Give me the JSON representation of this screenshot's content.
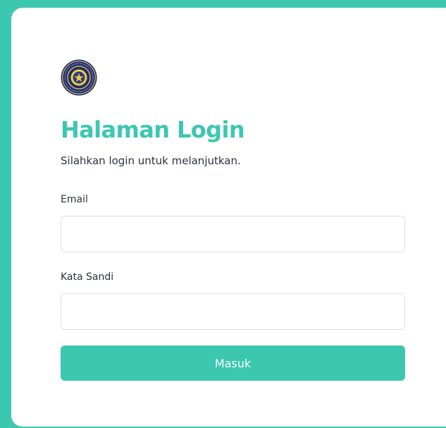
{
  "colors": {
    "accent": "#3cc7b1",
    "text": "#2e3140",
    "background": "#ffffff",
    "input_border": "#dde0e6"
  },
  "logo": {
    "icon": "university-seal-icon"
  },
  "header": {
    "title": "Halaman Login",
    "subtitle": "Silahkan login untuk melanjutkan."
  },
  "form": {
    "email": {
      "label": "Email",
      "value": "",
      "placeholder": ""
    },
    "password": {
      "label": "Kata Sandi",
      "value": "",
      "placeholder": ""
    },
    "submit_label": "Masuk"
  }
}
